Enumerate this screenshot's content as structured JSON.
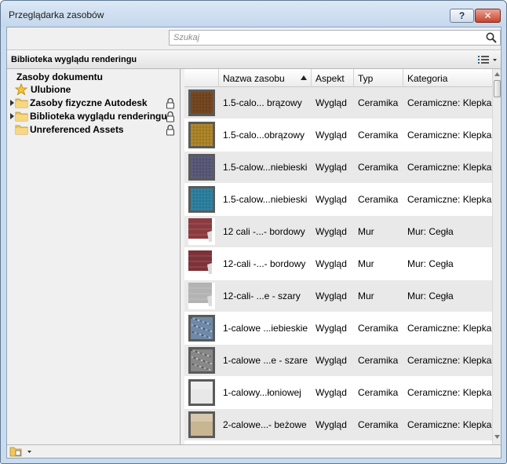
{
  "window": {
    "title": "Przeglądarka zasobów",
    "help_label": "?",
    "close_label": "✕"
  },
  "search": {
    "placeholder": "Szukaj",
    "value": ""
  },
  "library_bar": {
    "title": "Biblioteka wyglądu renderingu"
  },
  "tree": {
    "document_assets": "Zasoby dokumentu",
    "items": [
      {
        "label": "Ulubione",
        "icon": "star-icon",
        "locked": false,
        "expandable": false
      },
      {
        "label": "Zasoby fizyczne Autodesk",
        "icon": "folder-icon",
        "locked": true,
        "expandable": true
      },
      {
        "label": "Biblioteka wyglądu renderingu",
        "icon": "folder-icon",
        "locked": true,
        "expandable": true
      },
      {
        "label": "Unreferenced Assets",
        "icon": "folder-icon",
        "locked": true,
        "expandable": false
      }
    ]
  },
  "table": {
    "columns": [
      "",
      "Nazwa zasobu",
      "Aspekt",
      "Typ",
      "Kategoria"
    ],
    "sort_column": "Nazwa zasobu",
    "sort_direction": "ascending",
    "rows": [
      {
        "name": "1.5-calo... brązowy",
        "aspect": "Wygląd",
        "type": "Ceramika",
        "category": "Ceramiczne: Klepka",
        "swatch": "#7a4a22",
        "pattern": "tile"
      },
      {
        "name": "1.5-calo...obrązowy",
        "aspect": "Wygląd",
        "type": "Ceramika",
        "category": "Ceramiczne: Klepka",
        "swatch": "#b48a2a",
        "pattern": "tile"
      },
      {
        "name": "1.5-calow...niebieski",
        "aspect": "Wygląd",
        "type": "Ceramika",
        "category": "Ceramiczne: Klepka",
        "swatch": "#5d5d7e",
        "pattern": "tile"
      },
      {
        "name": "1.5-calow...niebieski",
        "aspect": "Wygląd",
        "type": "Ceramika",
        "category": "Ceramiczne: Klepka",
        "swatch": "#2f86a6",
        "pattern": "tile"
      },
      {
        "name": "12 cali -...- bordowy",
        "aspect": "Wygląd",
        "type": "Mur",
        "category": "Mur: Cegła",
        "swatch": "#8b3a3f",
        "pattern": "brick"
      },
      {
        "name": "12-cali -...- bordowy",
        "aspect": "Wygląd",
        "type": "Mur",
        "category": "Mur: Cegła",
        "swatch": "#7d3238",
        "pattern": "brick"
      },
      {
        "name": "12-cali- ...e - szary",
        "aspect": "Wygląd",
        "type": "Mur",
        "category": "Mur: Cegła",
        "swatch": "#b3b3b3",
        "pattern": "brick"
      },
      {
        "name": "1-calowe ...iebieskie",
        "aspect": "Wygląd",
        "type": "Ceramika",
        "category": "Ceramiczne: Klepka",
        "swatch": "#6f8aa8",
        "pattern": "granite"
      },
      {
        "name": "1-calowe ...e - szare",
        "aspect": "Wygląd",
        "type": "Ceramika",
        "category": "Ceramiczne: Klepka",
        "swatch": "#888888",
        "pattern": "granite"
      },
      {
        "name": "1-calowy...łoniowej",
        "aspect": "Wygląd",
        "type": "Ceramika",
        "category": "Ceramiczne: Klepka",
        "swatch": "#e8e8e8",
        "pattern": "plain"
      },
      {
        "name": "2-calowe...- beżowe",
        "aspect": "Wygląd",
        "type": "Ceramika",
        "category": "Ceramiczne: Klepka",
        "swatch": "#c8b591",
        "pattern": "plain"
      }
    ]
  },
  "colors": {
    "frame": "#c9dbee",
    "close_button": "#c8442c",
    "row_alt": "#e9e9e9"
  }
}
